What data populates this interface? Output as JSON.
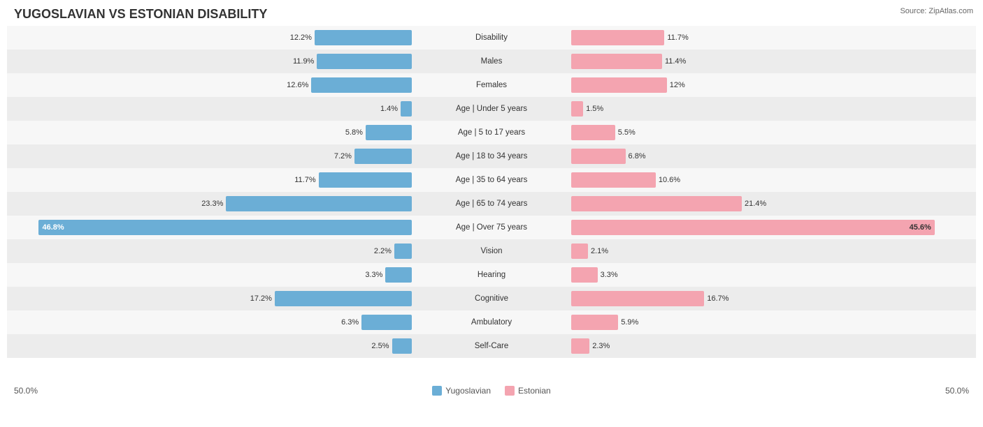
{
  "title": "YUGOSLAVIAN VS ESTONIAN DISABILITY",
  "source": "Source: ZipAtlas.com",
  "leftAxisLabel": "50.0%",
  "rightAxisLabel": "50.0%",
  "legend": {
    "items": [
      {
        "label": "Yugoslavian",
        "color": "#6baed6"
      },
      {
        "label": "Estonian",
        "color": "#f4a4b0"
      }
    ]
  },
  "rows": [
    {
      "label": "Disability",
      "leftVal": 12.2,
      "rightVal": 11.7,
      "leftPct": 24.4,
      "rightPct": 23.4
    },
    {
      "label": "Males",
      "leftVal": 11.9,
      "rightVal": 11.4,
      "leftPct": 23.8,
      "rightPct": 22.8
    },
    {
      "label": "Females",
      "leftVal": 12.6,
      "rightVal": 12.0,
      "leftPct": 25.2,
      "rightPct": 24.0
    },
    {
      "label": "Age | Under 5 years",
      "leftVal": 1.4,
      "rightVal": 1.5,
      "leftPct": 2.8,
      "rightPct": 3.0
    },
    {
      "label": "Age | 5 to 17 years",
      "leftVal": 5.8,
      "rightVal": 5.5,
      "leftPct": 11.6,
      "rightPct": 11.0
    },
    {
      "label": "Age | 18 to 34 years",
      "leftVal": 7.2,
      "rightVal": 6.8,
      "leftPct": 14.4,
      "rightPct": 13.6
    },
    {
      "label": "Age | 35 to 64 years",
      "leftVal": 11.7,
      "rightVal": 10.6,
      "leftPct": 23.4,
      "rightPct": 21.2
    },
    {
      "label": "Age | 65 to 74 years",
      "leftVal": 23.3,
      "rightVal": 21.4,
      "leftPct": 46.6,
      "rightPct": 42.8
    },
    {
      "label": "Age | Over 75 years",
      "leftVal": 46.8,
      "rightVal": 45.6,
      "leftPct": 93.6,
      "rightPct": 91.2,
      "special": true
    },
    {
      "label": "Vision",
      "leftVal": 2.2,
      "rightVal": 2.1,
      "leftPct": 4.4,
      "rightPct": 4.2
    },
    {
      "label": "Hearing",
      "leftVal": 3.3,
      "rightVal": 3.3,
      "leftPct": 6.6,
      "rightPct": 6.6
    },
    {
      "label": "Cognitive",
      "leftVal": 17.2,
      "rightVal": 16.7,
      "leftPct": 34.4,
      "rightPct": 33.4
    },
    {
      "label": "Ambulatory",
      "leftVal": 6.3,
      "rightVal": 5.9,
      "leftPct": 12.6,
      "rightPct": 11.8
    },
    {
      "label": "Self-Care",
      "leftVal": 2.5,
      "rightVal": 2.3,
      "leftPct": 5.0,
      "rightPct": 4.6
    }
  ]
}
